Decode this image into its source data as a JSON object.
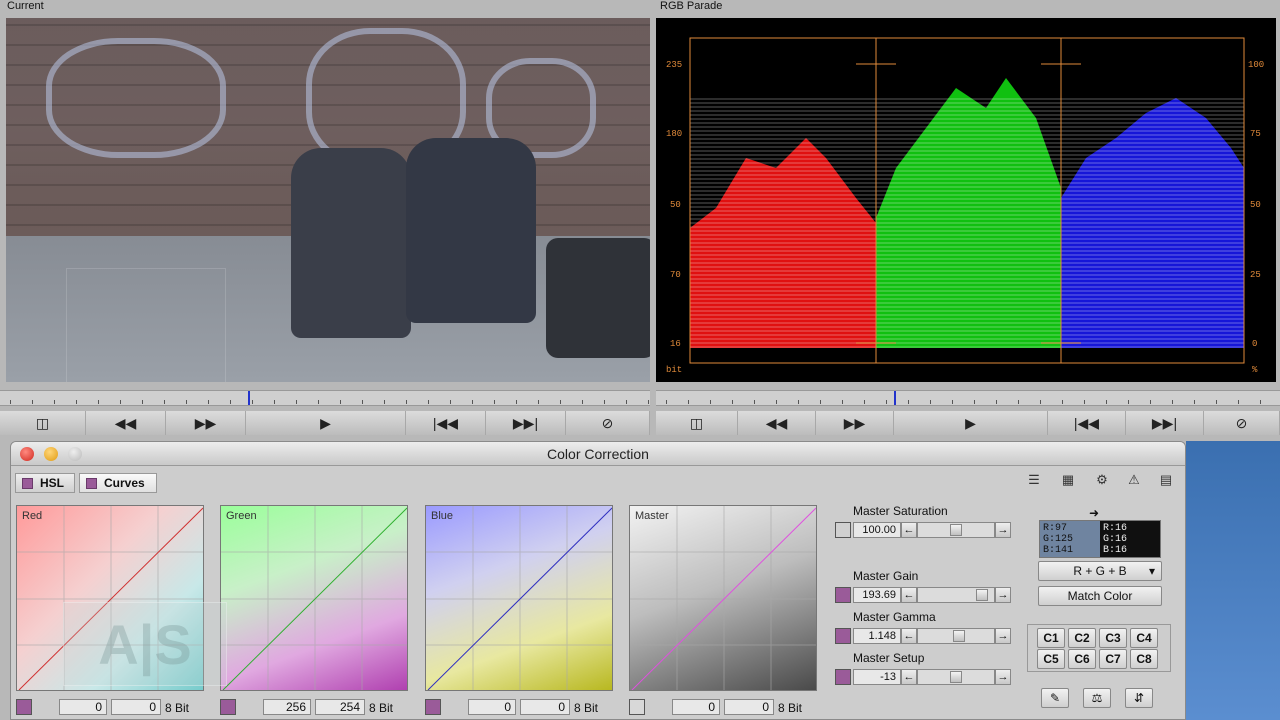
{
  "monitors": {
    "left_title": "Current",
    "right_title": "RGB Parade",
    "parade": {
      "left_scale": [
        "235",
        "180",
        "50",
        "70",
        "16"
      ],
      "right_scale": [
        "100",
        "75",
        "50",
        "25",
        "0"
      ],
      "left_unit": "bit",
      "right_unit": "%"
    }
  },
  "transport": {
    "icons": [
      "split-icon",
      "rewind-icon",
      "fast-forward-icon",
      "play-icon",
      "go-to-start-icon",
      "go-to-end-icon",
      "no-icon"
    ]
  },
  "window": {
    "title": "Color Correction",
    "tabs": [
      "HSL",
      "Curves"
    ]
  },
  "curves": [
    {
      "label": "Red",
      "in": "0",
      "out": "0",
      "bit": "8 Bit"
    },
    {
      "label": "Green",
      "in": "256",
      "out": "254",
      "bit": "8 Bit"
    },
    {
      "label": "Blue",
      "in": "0",
      "out": "0",
      "bit": "8 Bit"
    },
    {
      "label": "Master",
      "in": "0",
      "out": "0",
      "bit": "8 Bit"
    }
  ],
  "masters": [
    {
      "label": "Master Saturation",
      "value": "100.00",
      "level": 0.5
    },
    {
      "label": "Master Gain",
      "value": "193.69",
      "level": 0.9
    },
    {
      "label": "Master Gamma",
      "value": "1.148",
      "level": 0.55
    },
    {
      "label": "Master Setup",
      "value": "-13",
      "level": 0.5
    }
  ],
  "match": {
    "current": [
      "R:97",
      "G:125",
      "B:141"
    ],
    "target": [
      "R:16",
      "G:16",
      "B:16"
    ],
    "channel_select": "R + G + B",
    "match_button": "Match Color",
    "presets": [
      "C1",
      "C2",
      "C3",
      "C4",
      "C5",
      "C6",
      "C7",
      "C8"
    ]
  },
  "watermark": "A|S"
}
